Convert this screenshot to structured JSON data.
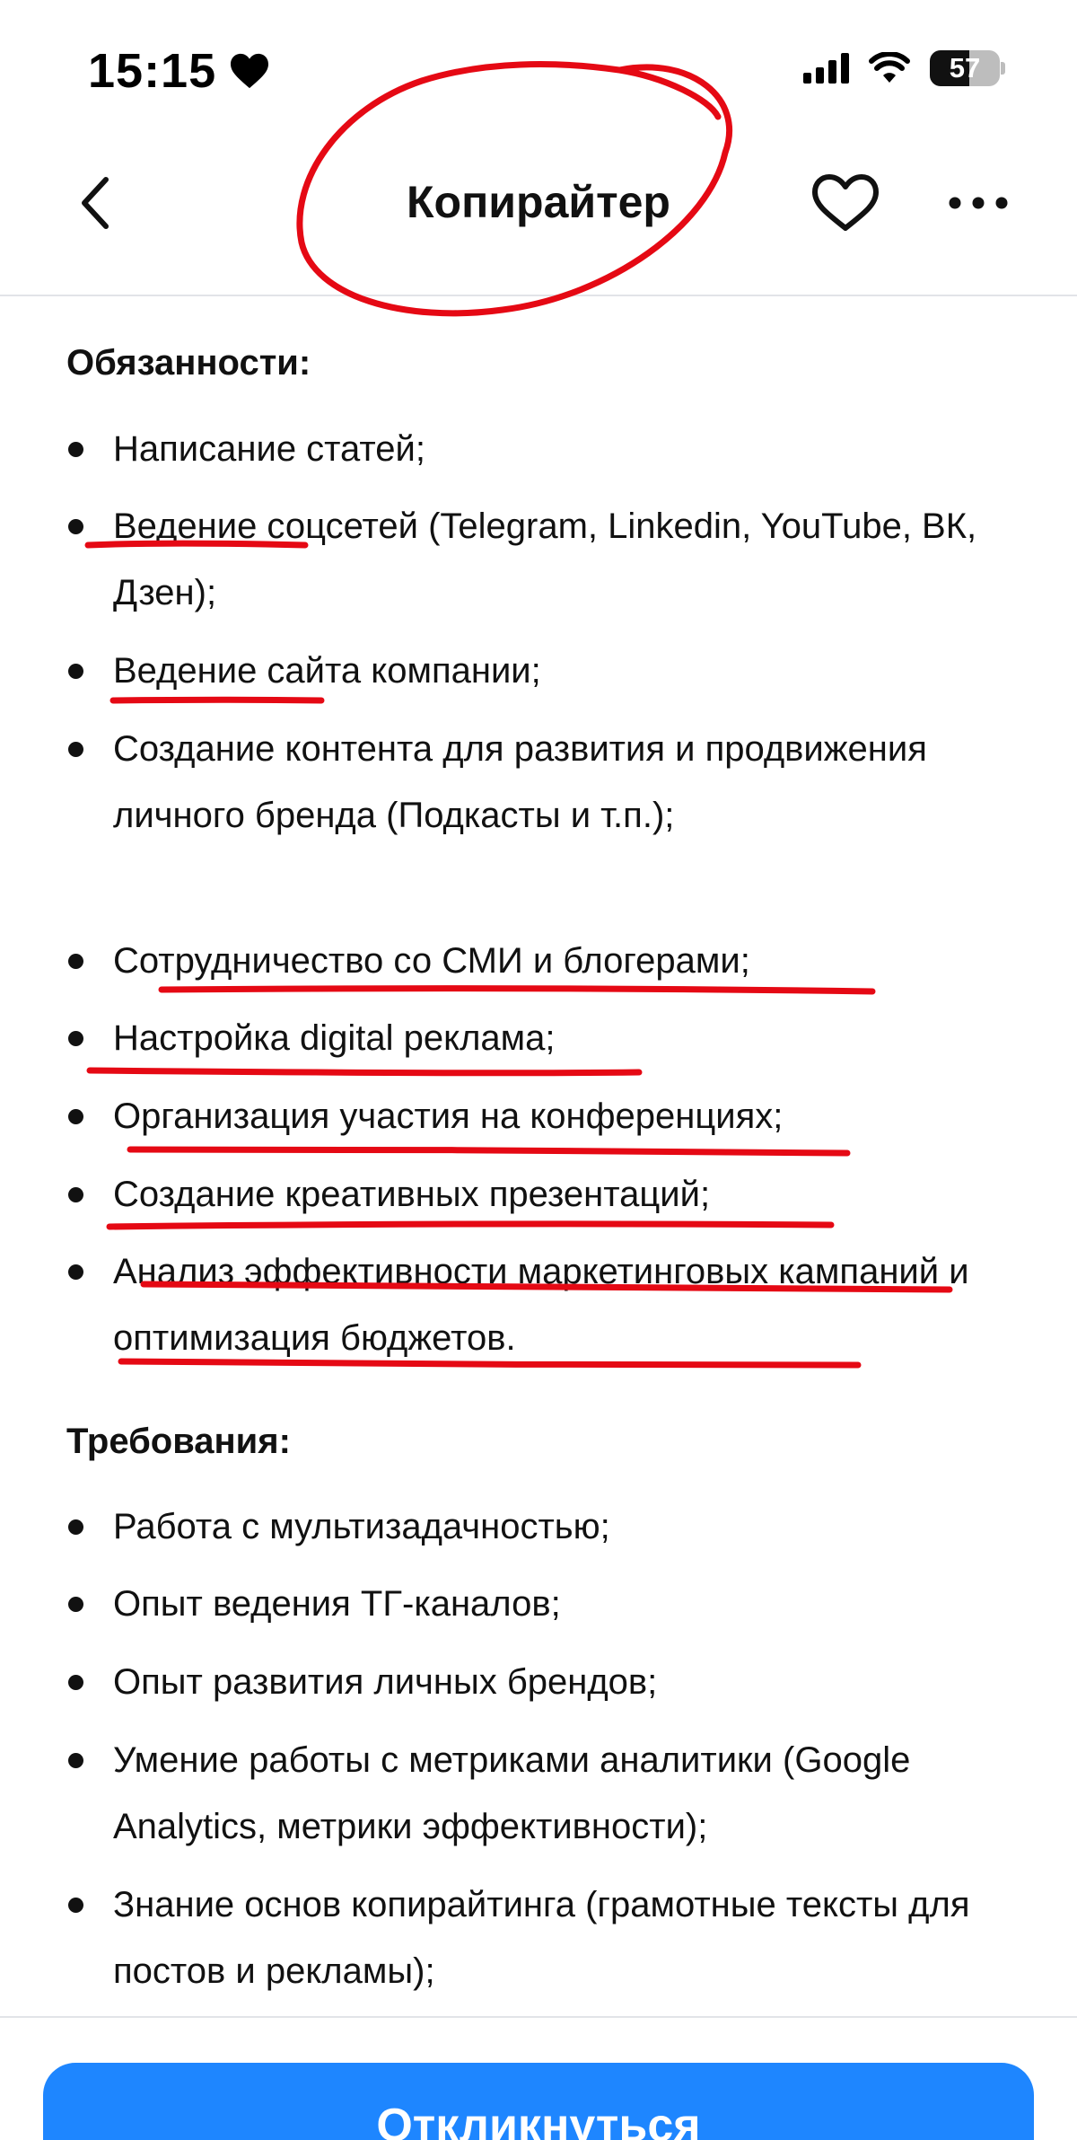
{
  "status_bar": {
    "time": "15:15",
    "battery": "57",
    "battery_level": 0.57
  },
  "nav": {
    "title": "Копирайтер"
  },
  "responsibilities": {
    "title": "Обязанности:",
    "items": [
      "Написание статей;",
      "Ведение соцсетей (Telegram, Linkedin, YouTube, ВК, Дзен);",
      "Ведение сайта компании;",
      "Создание контента для развития и продвижения личного бренда (Подкасты и т.п.);",
      "Сотрудничество со СМИ и блогерами;",
      "Настройка digital реклама;",
      "Организация участия на конференциях;",
      "Создание креативных презентаций;",
      "Анализ эффективности маркетинговых кампаний и оптимизация бюджетов."
    ]
  },
  "requirements": {
    "title": "Требования:",
    "items": [
      "Работа с мультизадачностью;",
      "Опыт ведения ТГ-каналов;",
      "Опыт развития личных брендов;",
      "Умение работы с метриками аналитики (Google Analytics, метрики эффективности);",
      "Знание основ копирайтинга (грамотные тексты для постов и рекламы);"
    ]
  },
  "apply_button": {
    "label": "Откликнуться"
  },
  "colors": {
    "accent": "#1e86ff",
    "annotation": "#e50914",
    "divider": "#e2e4e8"
  }
}
